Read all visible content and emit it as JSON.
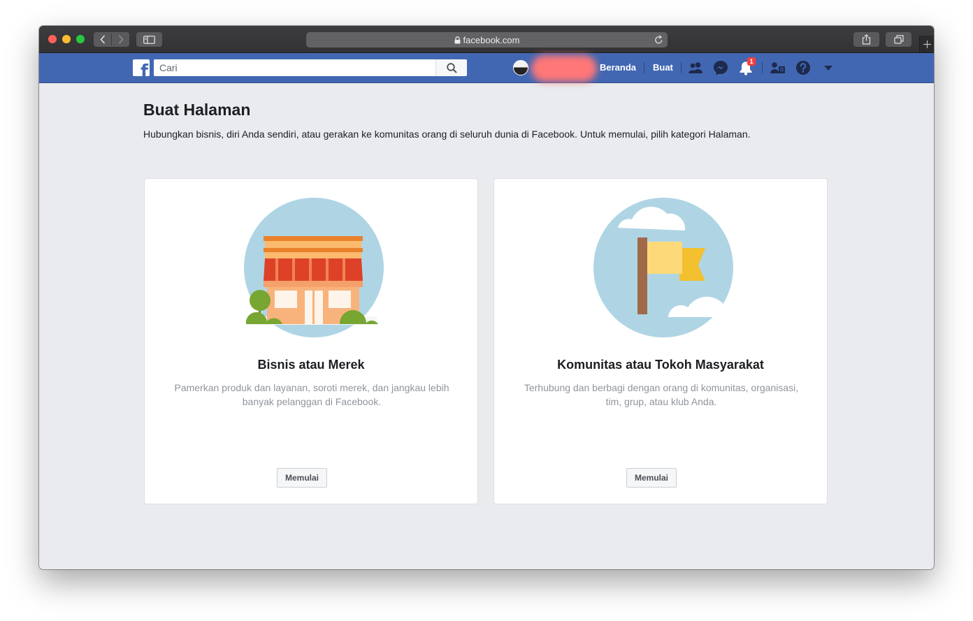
{
  "browser": {
    "url": "facebook.com"
  },
  "header": {
    "search_placeholder": "Cari",
    "nav_home": "Beranda",
    "nav_create": "Buat",
    "notification_count": "1",
    "icons": [
      "facebook-logo-icon",
      "search-icon",
      "friends-icon",
      "messenger-icon",
      "bell-icon",
      "find-friends-icon",
      "help-icon",
      "caret-down-icon"
    ]
  },
  "page": {
    "title": "Buat Halaman",
    "description": "Hubungkan bisnis, diri Anda sendiri, atau gerakan ke komunitas orang di seluruh dunia di Facebook. Untuk memulai, pilih kategori Halaman."
  },
  "cards": [
    {
      "title": "Bisnis atau Merek",
      "description": "Pamerkan produk dan layanan, soroti merek, dan jangkau lebih banyak pelanggan di Facebook.",
      "button": "Memulai",
      "illustration": "storefront-icon"
    },
    {
      "title": "Komunitas atau Tokoh Masyarakat",
      "description": "Terhubung dan berbagi dengan orang di komunitas, organisasi, tim, grup, atau klub Anda.",
      "button": "Memulai",
      "illustration": "flag-icon"
    }
  ],
  "colors": {
    "facebook_blue": "#4267b2",
    "page_background": "#e9ebee",
    "notification_badge": "#fa3e3e"
  }
}
